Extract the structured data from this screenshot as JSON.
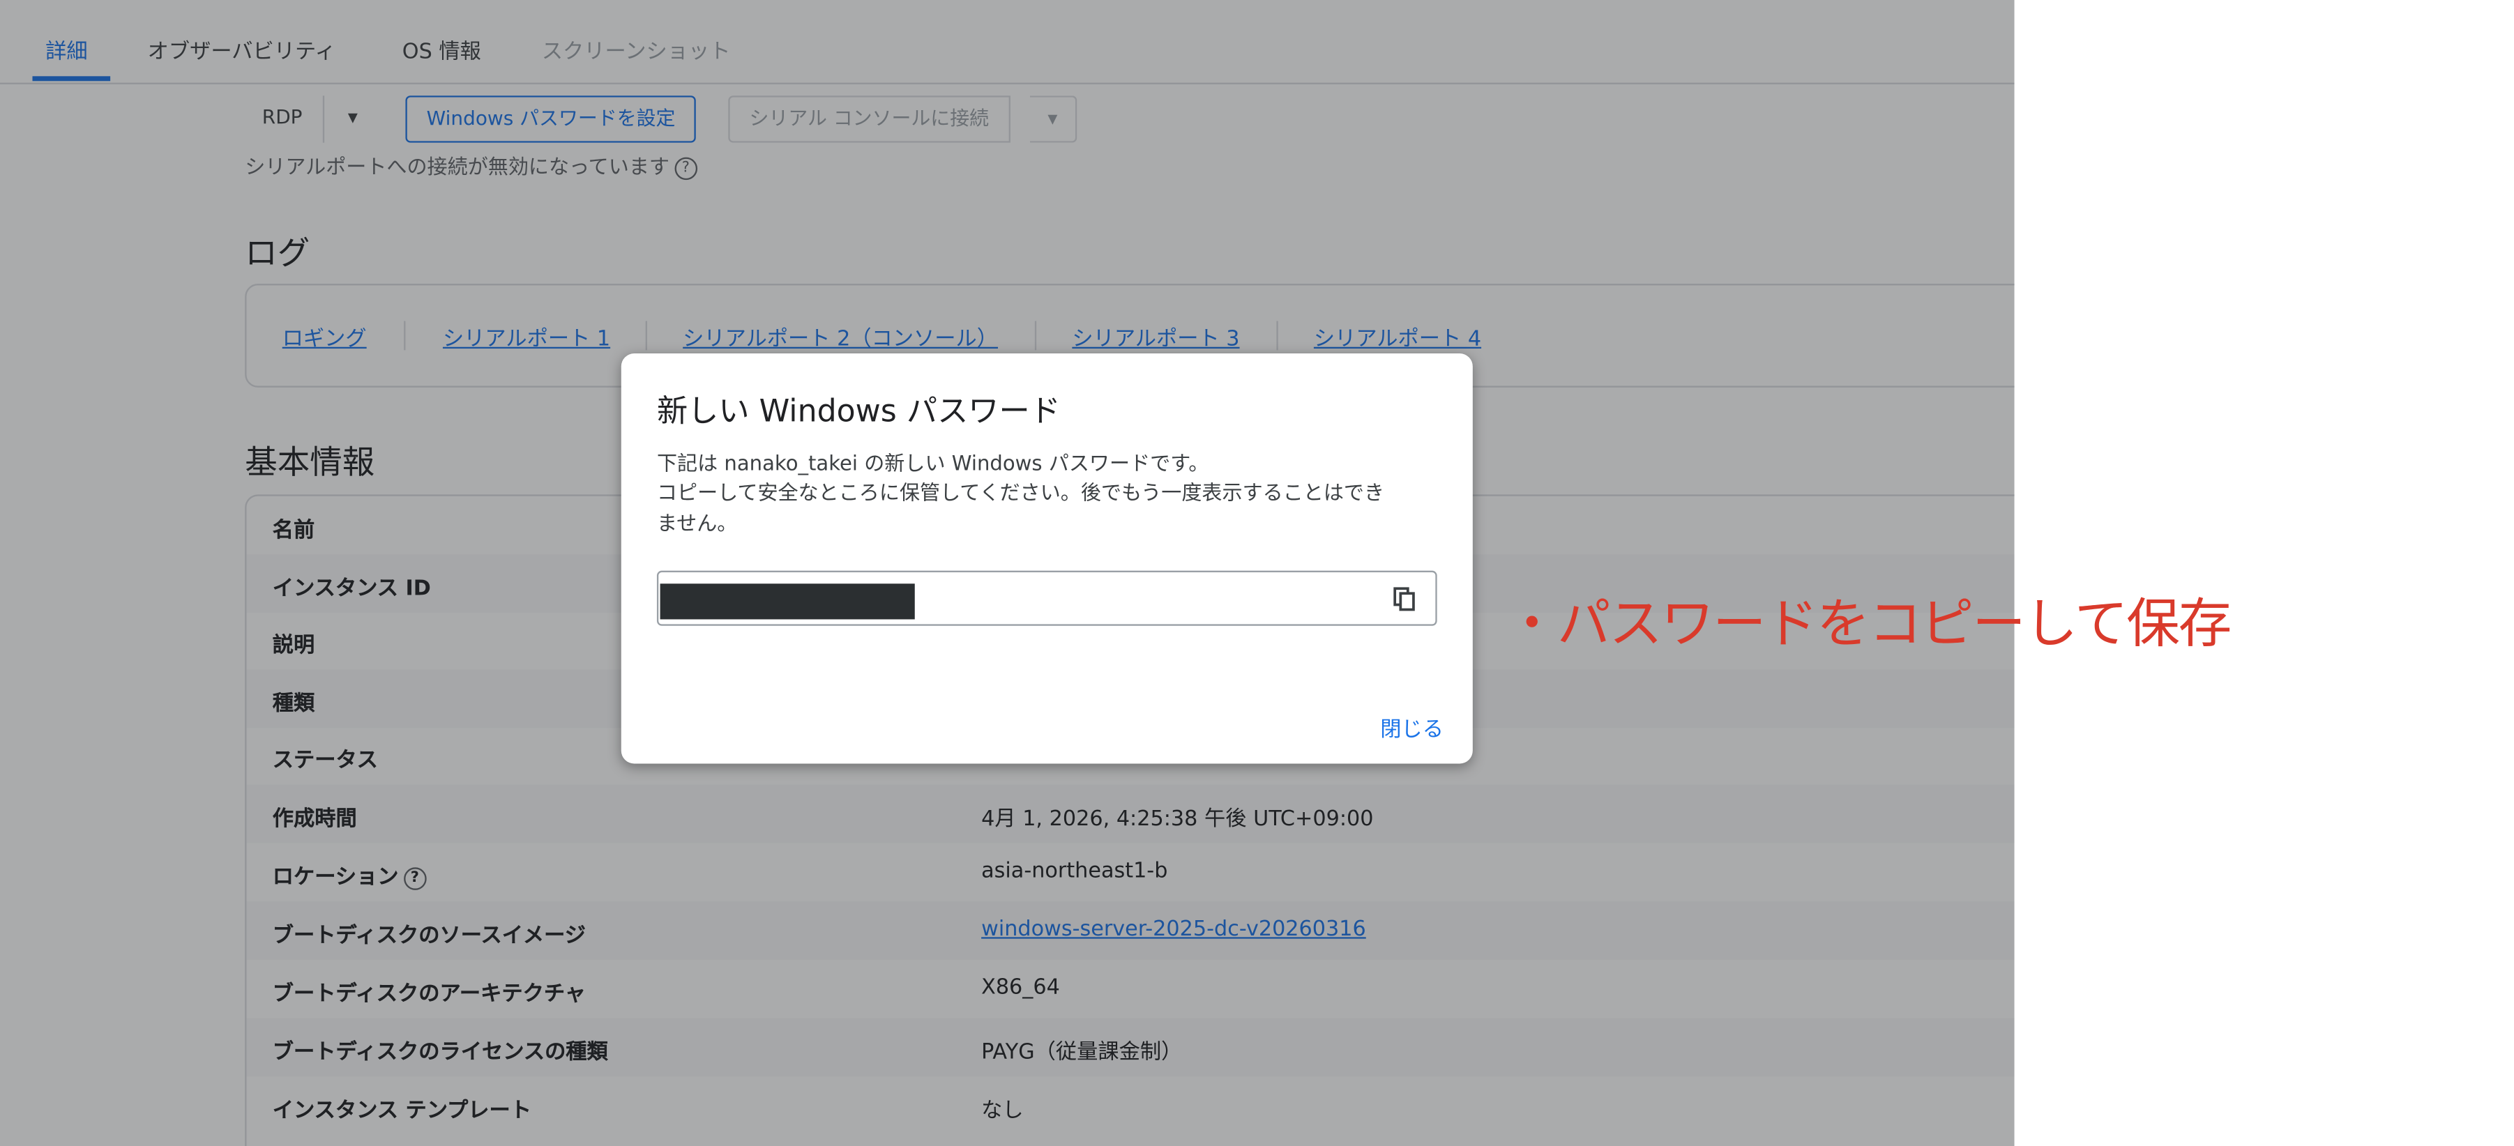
{
  "tabs": [
    {
      "label": "詳細",
      "active": true
    },
    {
      "label": "オブザーバビリティ"
    },
    {
      "label": "OS 情報"
    },
    {
      "label": "スクリーンショット",
      "disabled": true
    }
  ],
  "toolbar": {
    "rdp_label": "RDP",
    "rdp_dropdown": "▾",
    "set_windows_password": "Windows パスワードを設定",
    "serial_console": "シリアル コンソールに接続",
    "serial_dropdown": "▾",
    "serial_note": "シリアルポートへの接続が無効になっています",
    "help_glyph": "?"
  },
  "log_section": {
    "title": "ログ",
    "links": [
      "ロギング",
      "シリアルポート 1",
      "シリアルポート 2（コンソール）",
      "シリアルポート 3",
      "シリアルポート 4"
    ]
  },
  "basic_info": {
    "title": "基本情報",
    "rows": [
      {
        "label": "名前",
        "value": ""
      },
      {
        "label": "インスタンス ID",
        "value": ""
      },
      {
        "label": "説明",
        "value": ""
      },
      {
        "label": "種類",
        "value": ""
      },
      {
        "label": "ステータス",
        "value": ""
      },
      {
        "label": "作成時間",
        "value": "4月 1, 2026, 4:25:38 午後 UTC+09:00"
      },
      {
        "label": "ロケーション",
        "value": "asia-northeast1-b"
      },
      {
        "label": "ブートディスクのソースイメージ",
        "value": "windows-server-2025-dc-v20260316"
      },
      {
        "label": "ブートディスクのアーキテクチャ",
        "value": "X86_64"
      },
      {
        "label": "ブートディスクのライセンスの種類",
        "value": "PAYG（従量課金制）"
      },
      {
        "label": "インスタンス テンプレート",
        "value": "なし"
      }
    ]
  },
  "dialog": {
    "title": "新しい Windows パスワード",
    "line1": "下記は nanako_takei の新しい Windows パスワードです。",
    "line2": "コピーして安全なところに保管してください。後でもう一度表示することはでき",
    "line3": "ません。",
    "close_label": "閉じる"
  },
  "annotation": "・パスワードをコピーして保存",
  "colors": {
    "accent": "#1a73e8",
    "annotation": "#d93a2b",
    "password_mask": "#2b2f31"
  }
}
